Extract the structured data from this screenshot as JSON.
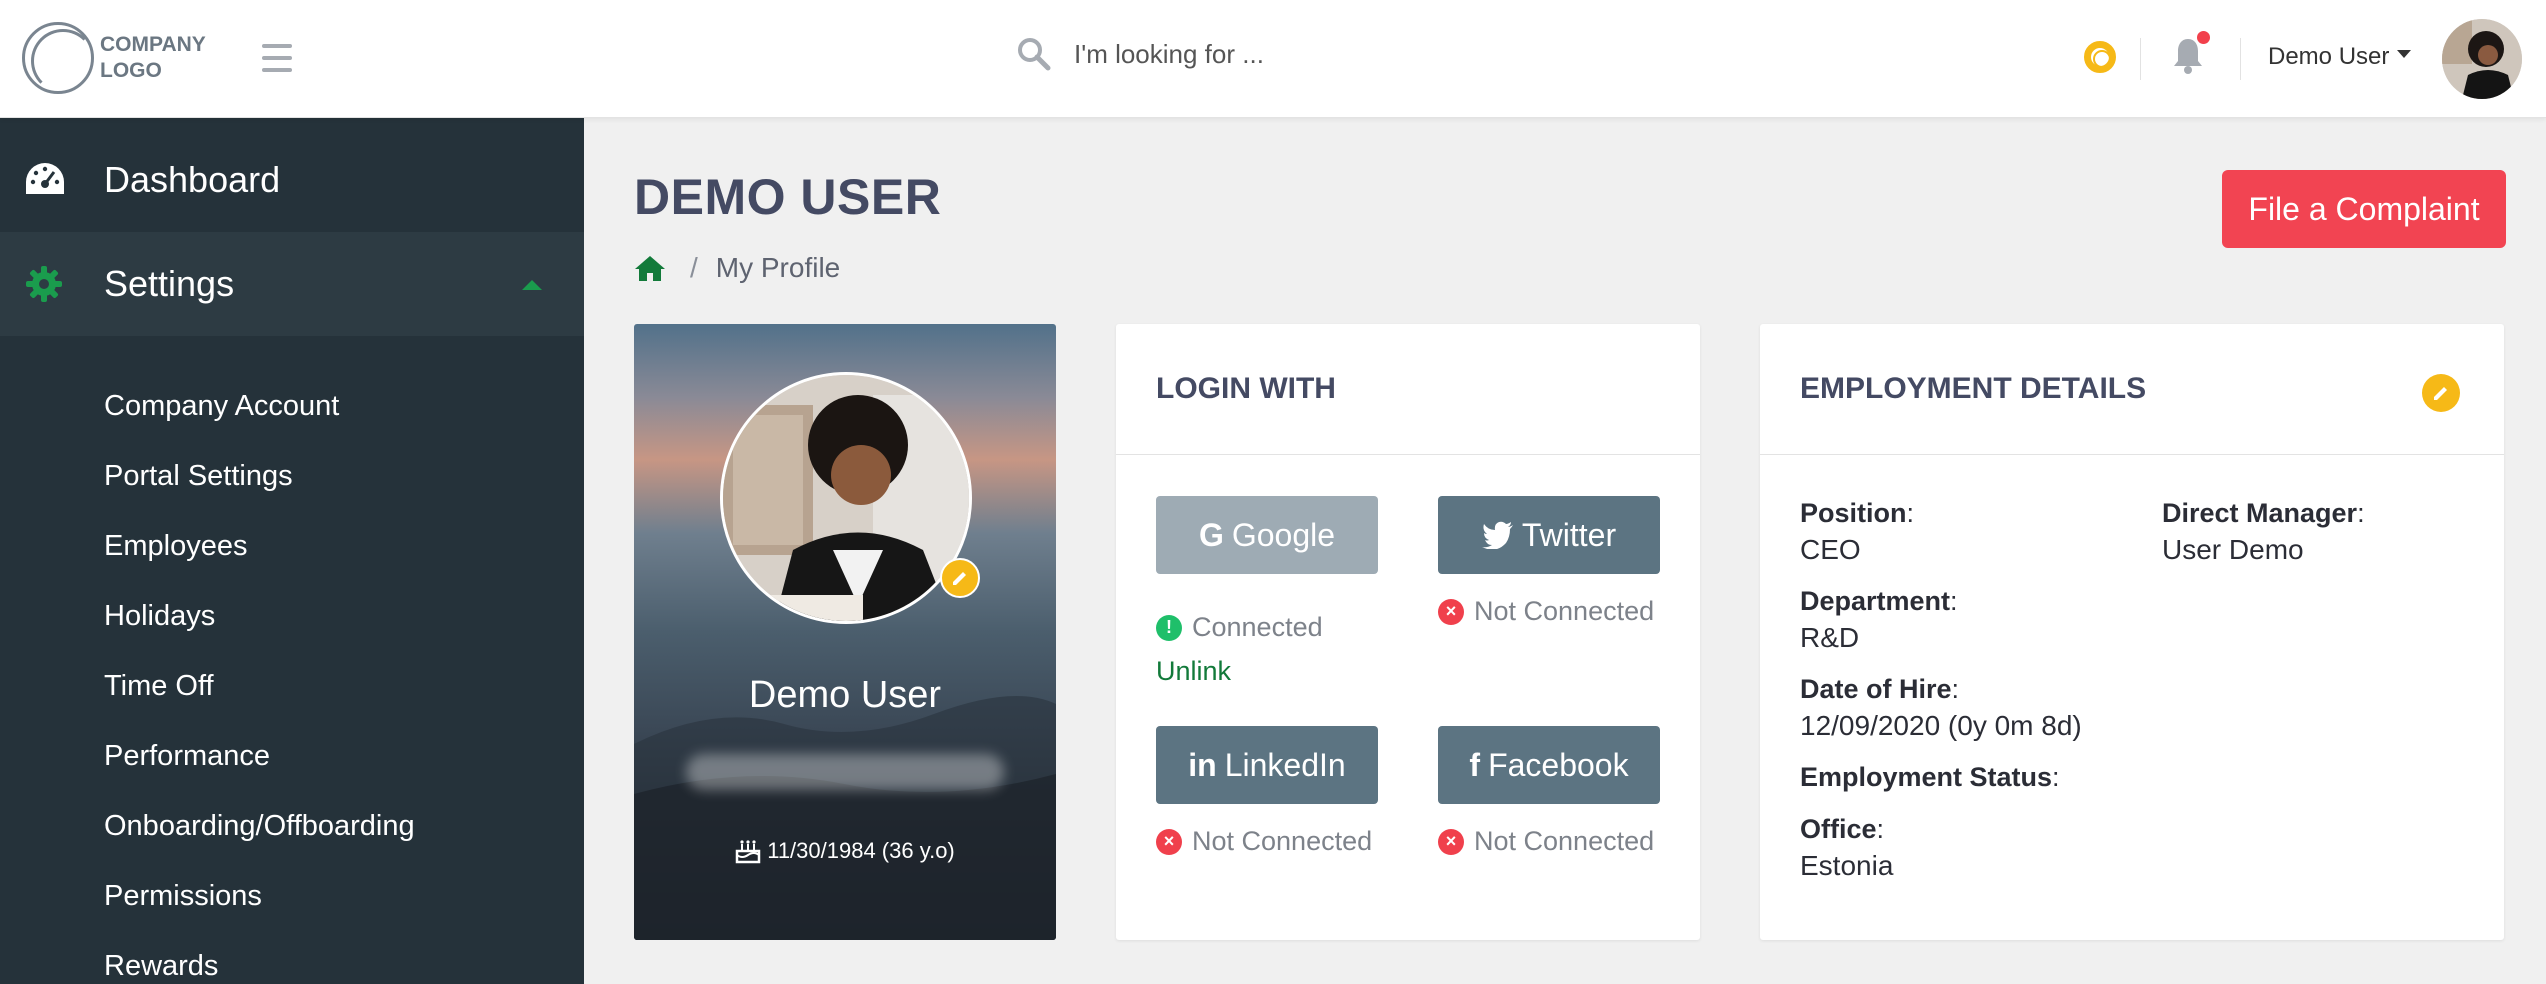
{
  "header": {
    "logo_line1": "COMPANY",
    "logo_line2": "LOGO",
    "search_placeholder": "I'm looking for ...",
    "user_name": "Demo User"
  },
  "sidebar": {
    "dashboard_label": "Dashboard",
    "settings_label": "Settings",
    "settings_items": [
      "Company Account",
      "Portal Settings",
      "Employees",
      "Holidays",
      "Time Off",
      "Performance",
      "Onboarding/Offboarding",
      "Permissions",
      "Rewards"
    ]
  },
  "page": {
    "title": "DEMO USER",
    "breadcrumb_current": "My Profile",
    "complaint_button": "File a Complaint"
  },
  "profile": {
    "name": "Demo User",
    "dob": "11/30/1984 (36 y.o)"
  },
  "login": {
    "title": "LOGIN WITH",
    "google_label": "Google",
    "google_status": "Connected",
    "google_action": "Unlink",
    "twitter_label": "Twitter",
    "twitter_status": "Not Connected",
    "linkedin_label": "LinkedIn",
    "linkedin_status": "Not Connected",
    "facebook_label": "Facebook",
    "facebook_status": "Not Connected"
  },
  "employment": {
    "title": "EMPLOYMENT DETAILS",
    "position_label": "Position",
    "position_value": "CEO",
    "manager_label": "Direct Manager",
    "manager_value": "User Demo",
    "department_label": "Department",
    "department_value": "R&D",
    "hire_label": "Date of Hire",
    "hire_value": "12/09/2020 (0y 0m 8d)",
    "status_label": "Employment Status",
    "office_label": "Office",
    "office_value": "Estonia"
  },
  "colors": {
    "sidebar_bg": "#25323a",
    "accent_green": "#1a9c4d",
    "danger": "#f24452",
    "warning": "#f6b917"
  }
}
